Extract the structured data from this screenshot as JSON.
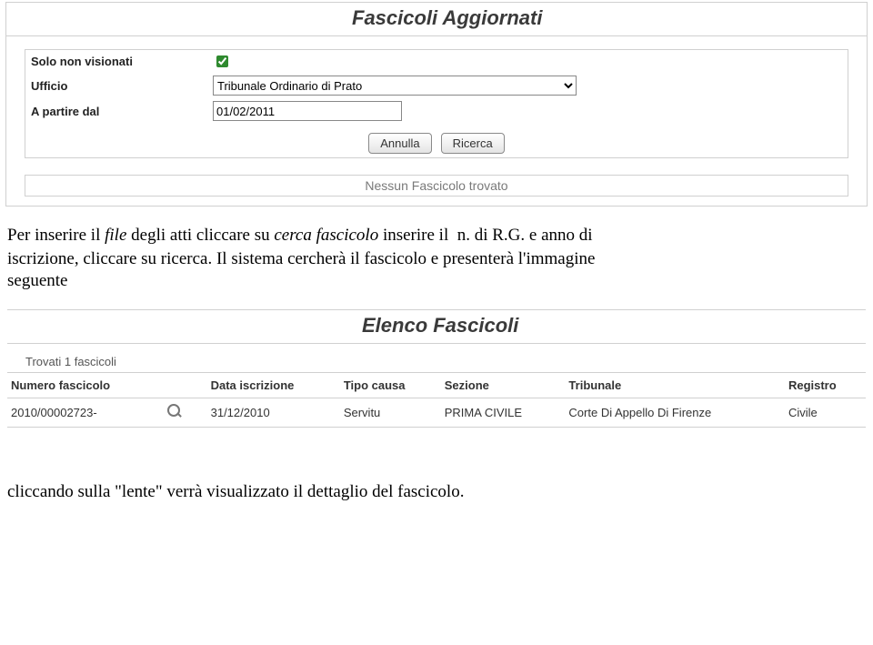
{
  "panel1": {
    "title": "Fascicoli Aggiornati",
    "labels": {
      "solo_non_visionati": "Solo non visionati",
      "ufficio": "Ufficio",
      "a_partire_dal": "A partire dal"
    },
    "values": {
      "ufficio_selected": "Tribunale Ordinario di Prato",
      "a_partire_dal": "01/02/2011"
    },
    "buttons": {
      "annulla": "Annulla",
      "ricerca": "Ricerca"
    },
    "status": "Nessun Fascicolo trovato"
  },
  "text1_line1": "Per inserire il file degli atti cliccare su cerca fascicolo inserire il  n. di R.G. e anno di",
  "text1_line2": "iscrizione, cliccare su ricerca. Il sistema cercherà il fascicolo e presenterà l'immagine",
  "text1_line3": "seguente",
  "panel2": {
    "title": "Elenco Fascicoli",
    "found": "Trovati 1 fascicoli",
    "headers": {
      "numero": "Numero fascicolo",
      "data": "Data iscrizione",
      "tipo": "Tipo causa",
      "sezione": "Sezione",
      "tribunale": "Tribunale",
      "registro": "Registro"
    },
    "row": {
      "numero": "2010/00002723-",
      "data": "31/12/2010",
      "tipo": "Servitu",
      "sezione": "PRIMA CIVILE",
      "tribunale": "Corte Di Appello Di Firenze",
      "registro": "Civile"
    }
  },
  "footer": "cliccando sulla \"lente\" verrà visualizzato il dettaglio del fascicolo."
}
